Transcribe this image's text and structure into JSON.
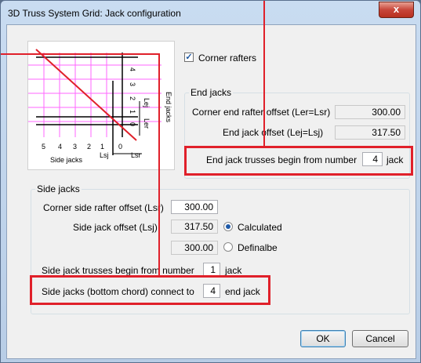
{
  "window": {
    "title": "3D Truss System Grid: Jack configuration",
    "close_label": "x"
  },
  "diagram": {
    "x_ticks": [
      "5",
      "4",
      "3",
      "2",
      "1",
      "0"
    ],
    "y_ticks": [
      "4",
      "3",
      "2",
      "1",
      "0"
    ],
    "side_jacks_label": "Side jacks",
    "lsj_label": "Lsj",
    "lsr_label": "Lsr",
    "end_jacks_label": "End jacks",
    "lej_label": "Lej",
    "ler_label": "Ler"
  },
  "corner_rafters": {
    "label": "Corner rafters",
    "checked": true
  },
  "end_jacks": {
    "group_label": "End jacks",
    "corner_end_rafter_offset_label": "Corner end rafter offset (Ler=Lsr)",
    "corner_end_rafter_offset_value": "300.00",
    "end_jack_offset_label": "End jack offset (Lej=Lsj)",
    "end_jack_offset_value": "317.50",
    "begin_label": "End jack trusses begin from number",
    "begin_value": "4",
    "begin_suffix": "jack"
  },
  "side_jacks": {
    "group_label": "Side jacks",
    "corner_side_rafter_offset_label": "Corner side rafter offset (Lsr)",
    "corner_side_rafter_offset_value": "300.00",
    "side_jack_offset_label": "Side jack offset (Lsj)",
    "calculated_value": "317.50",
    "calculated_label": "Calculated",
    "definable_value": "300.00",
    "definable_label": "Definalbe",
    "begin_label": "Side jack trusses begin from number",
    "begin_value": "1",
    "begin_suffix": "jack",
    "connect_label": "Side jacks (bottom chord) connect to",
    "connect_value": "4",
    "connect_suffix": "end jack"
  },
  "buttons": {
    "ok": "OK",
    "cancel": "Cancel"
  },
  "colors": {
    "highlight": "#e0202a",
    "grid_pink": "#ff66ff"
  }
}
